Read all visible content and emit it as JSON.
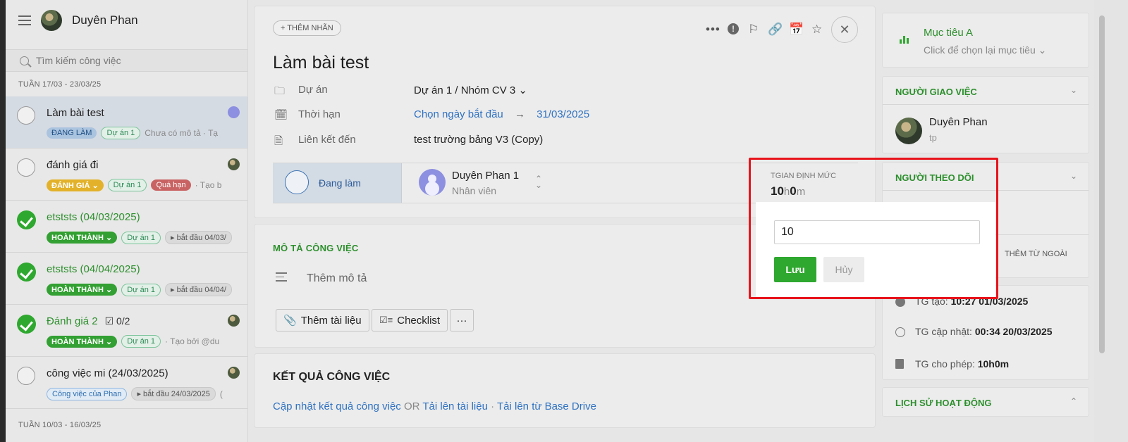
{
  "sidebar": {
    "user_name": "Duyên Phan",
    "search_placeholder": "Tìm kiếm công việc",
    "week1": "TUẦN 17/03 - 23/03/25",
    "week2": "TUẦN 10/03 - 16/03/25",
    "tasks": [
      {
        "title": "Làm bài test",
        "status": "ĐANG LÀM",
        "project": "Dự án 1",
        "extra": "Chưa có mô tả · Tạ"
      },
      {
        "title": "đánh giá đi",
        "status": "ĐÁNH GIÁ ⌄",
        "project": "Dự án 1",
        "late": "Quá hạn",
        "extra": "· Tạo b"
      },
      {
        "title": "etststs (04/03/2025)",
        "status": "HOÀN THÀNH ⌄",
        "project": "Dự án 1",
        "start": "▸ bắt đầu 04/03/"
      },
      {
        "title": "etststs (04/04/2025)",
        "status": "HOÀN THÀNH ⌄",
        "project": "Dự án 1",
        "start": "▸ bắt đầu 04/04/"
      },
      {
        "title": "Đánh giá 2",
        "checklist": "☑ 0/2",
        "status": "HOÀN THÀNH ⌄",
        "project": "Dự án 1",
        "extra": "· Tạo bởi @du"
      },
      {
        "title": "công việc mi (24/03/2025)",
        "project": "Công việc của Phan",
        "start": "▸ bắt đầu 24/03/2025",
        "extra": "("
      }
    ]
  },
  "main": {
    "add_label": "+ THÊM NHÃN",
    "title": "Làm bài test",
    "fields": {
      "project_label": "Dự án",
      "project_value": "Dự án 1  /  Nhóm CV 3 ⌄",
      "deadline_label": "Thời hạn",
      "deadline_start": "Chọn ngày bắt đầu",
      "deadline_arrow": "→",
      "deadline_end": "31/03/2025",
      "link_label": "Liên kết đến",
      "link_value": "test trường bảng V3 (Copy)"
    },
    "status": {
      "label": "Đang làm",
      "assignee_name": "Duyên Phan 1",
      "assignee_role": "Nhân viên",
      "norm_label": "TGIAN ĐỊNH MỨC",
      "norm_h": "10",
      "norm_h_unit": "h",
      "norm_m": "0",
      "norm_m_unit": "m"
    },
    "description": {
      "title": "MÔ TẢ CÔNG VIỆC",
      "placeholder": "Thêm mô tả",
      "add_doc": "Thêm tài liệu",
      "checklist": "Checklist",
      "more": "···"
    },
    "result": {
      "title": "KẾT QUẢ CÔNG VIỆC",
      "update": "Cập nhật kết quả công việc",
      "or": " OR ",
      "upload": "Tải lên tài liệu",
      "sep": " · ",
      "drive": "Tải lên từ Base Drive"
    }
  },
  "right": {
    "goal_title": "Mục tiêu A",
    "goal_sub": "Click để chọn lại mục tiêu ⌄",
    "assigner_head": "NGƯỜI GIAO VIỆC",
    "assigner_name": "Duyên Phan",
    "assigner_sub": "tp",
    "follower_head": "NGƯỜI THEO DÕI",
    "add_outside": "THÊM TỪ NGOÀI",
    "created_label": "TG tạo: ",
    "created_value": "10:27 01/03/2025",
    "updated_label": "TG cập nhật: ",
    "updated_value": "00:34 20/03/2025",
    "allowed_label": "TG cho phép: ",
    "allowed_value": "10h0m",
    "history_head": "LỊCH SỬ HOẠT ĐỘNG"
  },
  "popup": {
    "input_value": "10",
    "save": "Lưu",
    "cancel": "Hủy"
  }
}
